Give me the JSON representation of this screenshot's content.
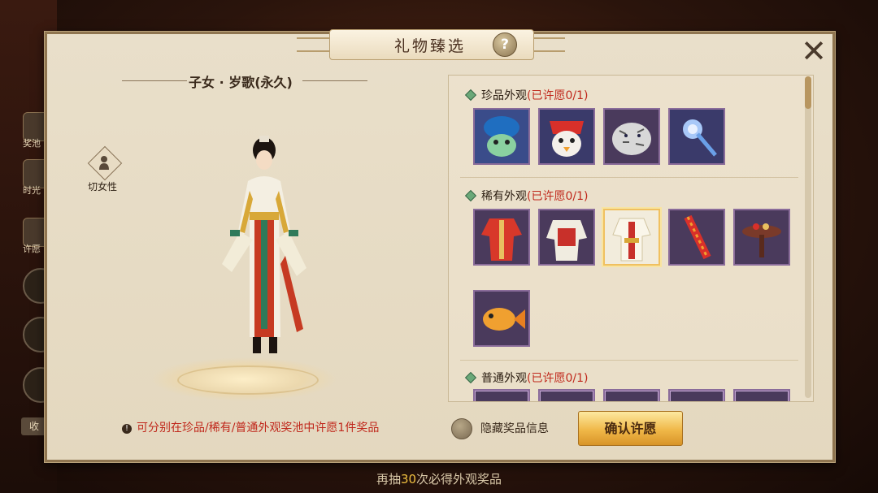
{
  "window": {
    "title": "礼物臻选"
  },
  "character": {
    "name": "子女 · 岁歌(永久)",
    "switch_gender_label": "切女性"
  },
  "hint": "可分别在珍品/稀有/普通外观奖池中许愿1件奖品",
  "hide_info_label": "隐藏奖品信息",
  "confirm_label": "确认许愿",
  "bottom_banner": {
    "prefix": "再抽",
    "count": "30",
    "suffix": "次必得外观奖品"
  },
  "sidebar": {
    "labels": [
      "奖池",
      "时光",
      "许愿"
    ],
    "collapse_label": "收"
  },
  "sections": [
    {
      "title": "珍品外观",
      "status": "(已许愿0/1)",
      "items": [
        "blue-hat-frog",
        "red-white-mask",
        "white-tiger",
        "crystal-staff"
      ]
    },
    {
      "title": "稀有外观",
      "status": "(已许愿0/1)",
      "items": [
        "red-robe",
        "white-red-outfit",
        "selected-outfit",
        "firecrackers",
        "tea-table",
        "golden-fish"
      ]
    },
    {
      "title": "普通外观",
      "status": "(已许愿0/1)",
      "items": [
        "item-a",
        "item-b",
        "item-c",
        "item-d",
        "item-e"
      ]
    }
  ],
  "colors": {
    "accent": "#c0281c",
    "slot_border": "#8a6c9a",
    "gold": "#f0b848"
  }
}
